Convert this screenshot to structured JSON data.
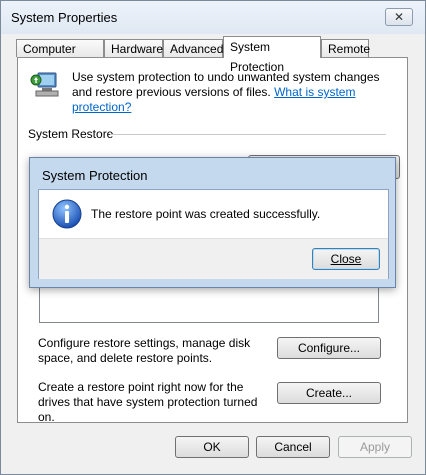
{
  "window": {
    "title": "System Properties",
    "close_glyph": "✕"
  },
  "tabs": [
    {
      "label": "Computer Name"
    },
    {
      "label": "Hardware"
    },
    {
      "label": "Advanced"
    },
    {
      "label": "System Protection",
      "active": true
    },
    {
      "label": "Remote"
    }
  ],
  "intro": {
    "text": "Use system protection to undo unwanted system changes and restore previous versions of files.",
    "link": "What is system protection?"
  },
  "system_restore": {
    "section_title": "System Restore"
  },
  "configure": {
    "description": "Configure restore settings, manage disk space, and delete restore points.",
    "button": "Configure..."
  },
  "create": {
    "description": "Create a restore point right now for the drives that have system protection turned on.",
    "button": "Create..."
  },
  "footer": {
    "ok": "OK",
    "cancel": "Cancel",
    "apply": "Apply"
  },
  "dialog": {
    "title": "System Protection",
    "message": "The restore point was created successfully.",
    "close_button": "Close"
  }
}
